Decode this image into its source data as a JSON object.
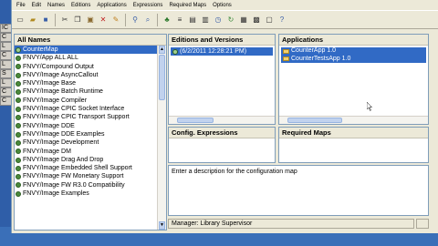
{
  "desktop": {
    "fragments": [
      "IC",
      "C",
      "L",
      "C",
      "L",
      "S",
      "L",
      "C",
      "C"
    ]
  },
  "menubar": {
    "items": [
      "File",
      "Edit",
      "Names",
      "Editions",
      "Applications",
      "Expressions",
      "Required Maps",
      "Options"
    ]
  },
  "toolbar": {
    "icons": [
      "new-icon",
      "open-icon",
      "save-icon",
      "cut-icon",
      "copy-icon",
      "paste-icon",
      "delete-icon",
      "undo-icon",
      "find-icon",
      "find-next-icon",
      "tree-icon",
      "list-icon",
      "properties-icon",
      "settings-icon",
      "clock-icon",
      "refresh-icon",
      "table-icon",
      "grid-icon",
      "window-icon",
      "help-icon"
    ]
  },
  "names_pane": {
    "title": "All Names",
    "rows": [
      {
        "label": "CounterMap",
        "selected": true
      },
      {
        "label": "FNVY/App ALL ALL",
        "selected": false
      },
      {
        "label": "FNVY/Compound Output",
        "selected": false
      },
      {
        "label": "FNVY/Image AsyncCallout",
        "selected": false
      },
      {
        "label": "FNVY/Image Base",
        "selected": false
      },
      {
        "label": "FNVY/Image Batch Runtime",
        "selected": false
      },
      {
        "label": "FNVY/Image Compiler",
        "selected": false
      },
      {
        "label": "FNVY/Image CPIC Socket Interface",
        "selected": false
      },
      {
        "label": "FNVY/Image CPIC Transport Support",
        "selected": false
      },
      {
        "label": "FNVY/Image DDE",
        "selected": false
      },
      {
        "label": "FNVY/Image DDE Examples",
        "selected": false
      },
      {
        "label": "FNVY/Image Development",
        "selected": false
      },
      {
        "label": "FNVY/Image DM",
        "selected": false
      },
      {
        "label": "FNVY/Image Drag And Drop",
        "selected": false
      },
      {
        "label": "FNVY/Image Embedded Shell Support",
        "selected": false
      },
      {
        "label": "FNVY/Image FW Monetary Support",
        "selected": false
      },
      {
        "label": "FNVY/Image FW R3.0 Compatibility",
        "selected": false
      },
      {
        "label": "FNVY/Image Examples",
        "selected": false
      }
    ]
  },
  "editions_pane": {
    "title": "Editions and Versions",
    "selected_row": "(6/2/2011 12:28:21 PM)"
  },
  "applications_pane": {
    "title": "Applications",
    "rows": [
      "CounterApp 1.0",
      "CounterTestsApp 1.0"
    ]
  },
  "config_pane": {
    "title": "Config. Expressions"
  },
  "required_maps_pane": {
    "title": "Required Maps"
  },
  "description_pane": {
    "text": "Enter a description for the configuration map"
  },
  "statusbar": {
    "text": "Manager: Library Supervisor"
  }
}
